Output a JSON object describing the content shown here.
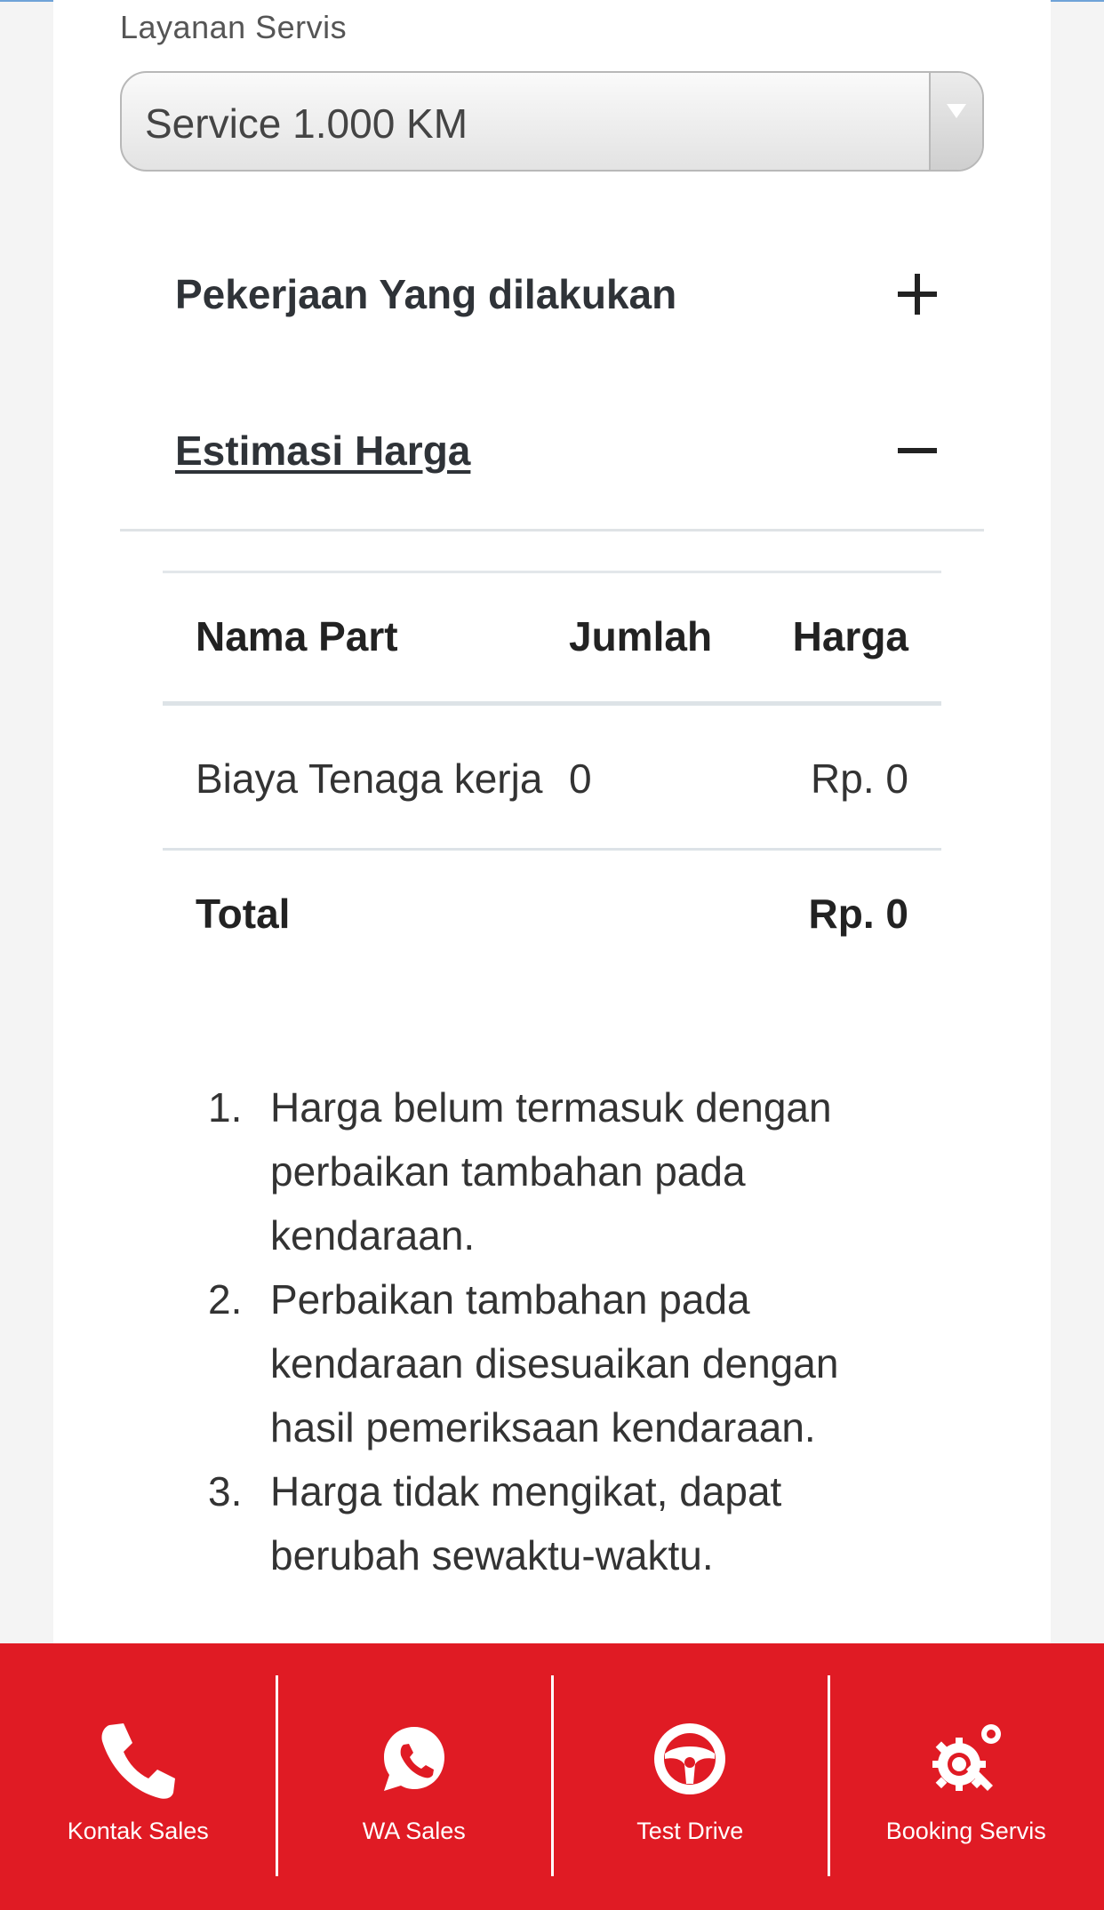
{
  "service_field": {
    "label": "Layanan Servis",
    "selected": "Service 1.000 KM"
  },
  "accordion": {
    "work": {
      "title": "Pekerjaan Yang dilakukan",
      "state": "collapsed"
    },
    "estimate": {
      "title": "Estimasi Harga",
      "state": "expanded"
    }
  },
  "price_table": {
    "headers": {
      "part": "Nama Part",
      "qty": "Jumlah",
      "price": "Harga"
    },
    "rows": [
      {
        "part": "Biaya Tenaga kerja",
        "qty": "0",
        "price": "Rp. 0"
      }
    ],
    "total": {
      "label": "Total",
      "value": "Rp. 0"
    }
  },
  "notes": [
    "Harga belum termasuk dengan perbaikan tambahan pada kendaraan.",
    "Perbaikan tambahan pada kendaraan disesuaikan dengan hasil pemeriksaan kendaraan.",
    "Harga tidak mengikat, dapat berubah sewaktu-waktu."
  ],
  "bottom_nav": {
    "items": [
      {
        "label": "Kontak Sales",
        "icon": "phone-icon"
      },
      {
        "label": "WA Sales",
        "icon": "whatsapp-icon"
      },
      {
        "label": "Test Drive",
        "icon": "steering-wheel-icon"
      },
      {
        "label": "Booking Servis",
        "icon": "service-gear-icon"
      }
    ]
  },
  "colors": {
    "bottom_bar": "#e01b24",
    "card": "#ffffff",
    "background": "#f4f4f4"
  }
}
